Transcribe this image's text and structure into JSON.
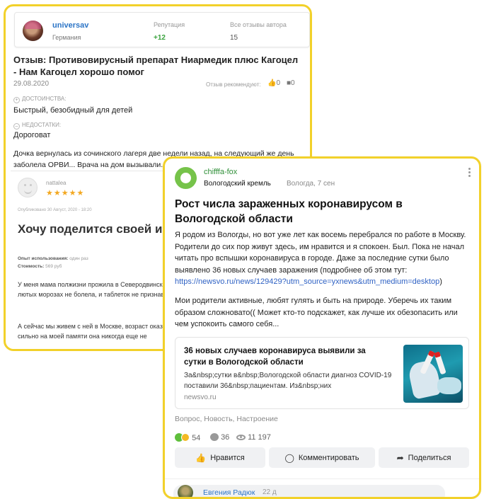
{
  "review": {
    "username": "universav",
    "country": "Германия",
    "reputation_label": "Репутация",
    "reputation_value": "+12",
    "all_reviews_label": "Все отзывы автора",
    "all_reviews_value": "15",
    "title": "Отзыв: Противовирусный препарат Ниармедик плюс Кагоцел - Нам Кагоцел хорошо помог",
    "date": "29.08.2020",
    "recommend_label": "Отзыв рекомендуют:",
    "likes": "0",
    "comments": "0",
    "pros_label": "ДОСТОИНСТВА:",
    "pros": "Быстрый, безобидный для детей",
    "cons_label": "НЕДОСТАТКИ:",
    "cons": "Дороговат",
    "body": "Дочка вернулась из сочинского лагеря две недели назад, на следующий же день заболела ОРВИ... Врача на дом вызывали. Прописал"
  },
  "inner_review": {
    "username": "nattalea",
    "stars": "★★★★★",
    "posted": "Опубликовано 30 Август, 2020 - 18:20",
    "title": "Хочу поделится своей историей с препаратом..",
    "usage_label": "Опыт использования:",
    "usage_value": "один раз",
    "cost_label": "Стоимость:",
    "cost_value": "569 руб",
    "p1": "У меня мама полжизни прожила в Северодвинске, постоянно на открытом воздухе и даже при лютых морозах не болела, и таблеток не признавала как и прививки.",
    "p2": "А сейчас мы живем с ней в Москве, возраст оказывает влияние! иногда все же болеет. В мае так сильно на моей памяти она никогда еще не"
  },
  "post": {
    "author": "chifffa-fox",
    "source": "Вологодский кремль",
    "location_time": "Вологда, 7 сен",
    "title": "Рост числа зараженных коронавирусом в Вологодской области",
    "text1": "Я родом из Вологды, но вот уже лет как восемь перебрался по работе в Москву. Родители до сих пор живут здесь, им нравится и я спокоен. Был. Пока не начал читать про вспышки коронавируса в городе. Даже за последние сутки было выявлено 36 новых случаев заражения (подробнее об этом тут: ",
    "link": "https://newsvo.ru/news/129429?utm_source=yxnews&utm_medium=desktop",
    "text1_end": ")",
    "text2": "Мои родители активные, любят гулять и быть на природе. Уберечь их таким образом сложновато(( Может кто-то подскажет, как лучше их обезопасить или чем успокоить самого себя...",
    "link_card": {
      "title": "36 новых случаев коронавируса выявили за сутки в Вологодской области",
      "description": "За&nbsp;сутки в&nbsp;Вологодской области диагноз COVID-19 поставили 36&nbsp;пациентам. Из&nbsp;них",
      "site": "newsvo.ru"
    },
    "tags": "Вопрос, Новость, Настроение",
    "reactions": "54",
    "comments": "36",
    "views": "11 197",
    "like_btn": "Нравится",
    "comment_btn": "Комментировать",
    "share_btn": "Поделиться",
    "commenter": "Евгения Радюк",
    "comment_time": "22 д"
  },
  "colors": {
    "frame": "#f2d12a",
    "link": "#2b74c6",
    "green": "#3aa33e"
  }
}
